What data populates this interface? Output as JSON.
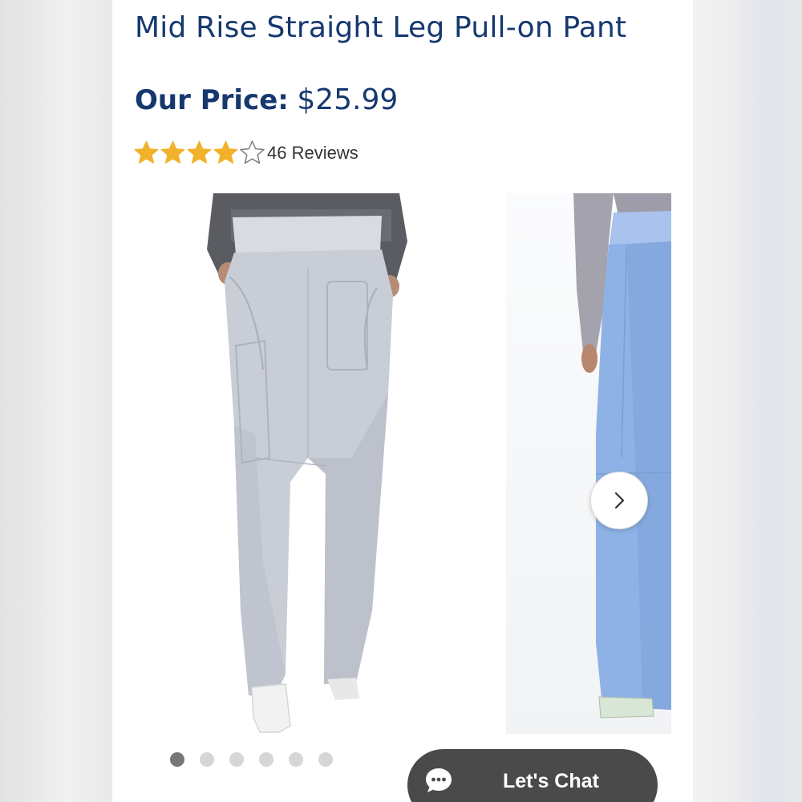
{
  "product": {
    "title": "Mid Rise Straight Leg Pull-on Pant",
    "price_label": "Our Price:",
    "price_value": "$25.99",
    "rating": {
      "value": 4,
      "max": 5,
      "reviews_text": "46 Reviews"
    }
  },
  "gallery": {
    "images": [
      {
        "name": "gray pull-on pant front view",
        "color": "#c8cdd6"
      },
      {
        "name": "ceil blue pull-on pant side view",
        "color": "#8eb2e6"
      }
    ],
    "dot_count": 6,
    "active_dot": 0,
    "next_icon": "chevron-right-icon"
  },
  "chat": {
    "label": "Let's Chat",
    "icon": "chat-bubble-icon"
  },
  "colors": {
    "brand_navy": "#15386f",
    "star_gold": "#f2b12a",
    "chat_bg": "#4a4a4a"
  }
}
